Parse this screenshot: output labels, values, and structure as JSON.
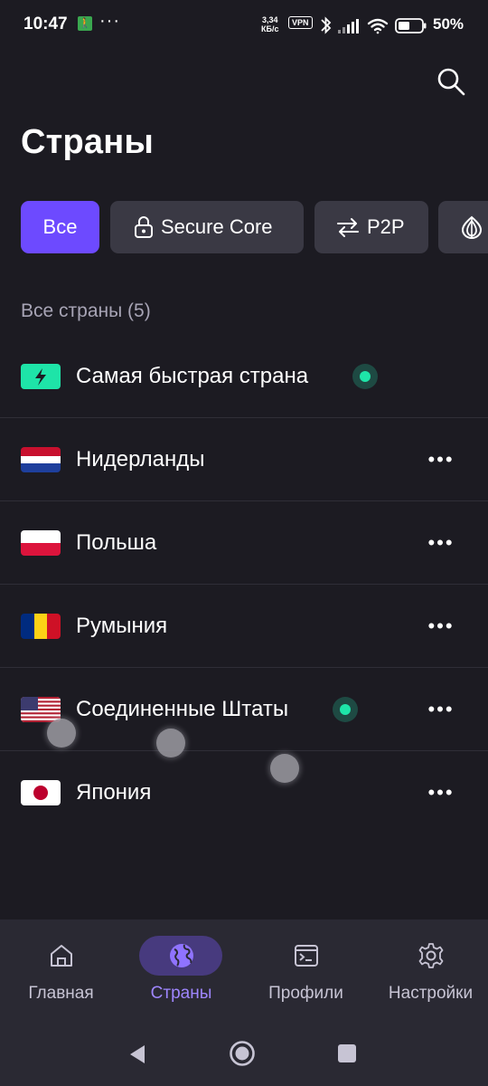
{
  "status_bar": {
    "time": "10:47",
    "dots": "···",
    "speed_value": "3,34",
    "speed_unit": "КБ/с",
    "vpn": "VPN",
    "battery": "50%"
  },
  "header": {
    "title": "Страны",
    "search_icon": "search-icon"
  },
  "filters": [
    {
      "label": "Все",
      "icon": "",
      "active": true
    },
    {
      "label": "Secure Core",
      "icon": "lock-icon",
      "active": false
    },
    {
      "label": "P2P",
      "icon": "swap-arrows-icon",
      "active": false
    },
    {
      "label": "",
      "icon": "tor-onion-icon",
      "active": false
    }
  ],
  "section": {
    "label": "Все страны (5)"
  },
  "countries": [
    {
      "name": "Самая быстрая страна",
      "flag": "fastest-lightning",
      "online": true,
      "more": ""
    },
    {
      "name": "Нидерланды",
      "flag": "nl",
      "online": false,
      "more": "•••"
    },
    {
      "name": "Польша",
      "flag": "pl",
      "online": false,
      "more": "•••"
    },
    {
      "name": "Румыния",
      "flag": "ro",
      "online": false,
      "more": "•••"
    },
    {
      "name": "Соединенные Штаты",
      "flag": "us",
      "online": true,
      "more": "•••"
    },
    {
      "name": "Япония",
      "flag": "jp",
      "online": false,
      "more": "•••"
    }
  ],
  "bottom_nav": [
    {
      "label": "Главная",
      "icon": "home-icon",
      "active": false
    },
    {
      "label": "Страны",
      "icon": "globe-icon",
      "active": true
    },
    {
      "label": "Профили",
      "icon": "terminal-icon",
      "active": false
    },
    {
      "label": "Настройки",
      "icon": "gear-icon",
      "active": false
    }
  ],
  "colors": {
    "background": "#1c1b22",
    "accent": "#6d4aff",
    "online": "#1ee4a8",
    "chip": "#3a3944"
  }
}
